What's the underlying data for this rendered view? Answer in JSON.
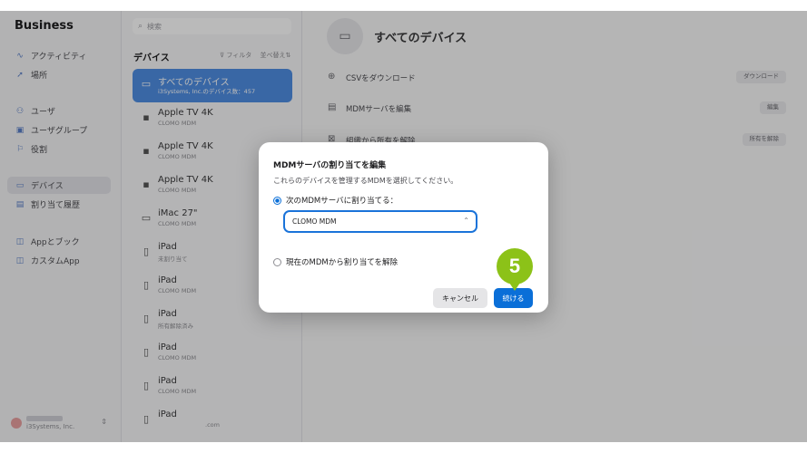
{
  "sidebar": {
    "brand": "Business",
    "items": [
      {
        "label": "アクティビティ",
        "icon": "activity-icon"
      },
      {
        "label": "場所",
        "icon": "location-icon"
      },
      {
        "label": "ユーザ",
        "icon": "users-icon"
      },
      {
        "label": "ユーザグループ",
        "icon": "user-group-icon"
      },
      {
        "label": "役割",
        "icon": "flag-icon"
      },
      {
        "label": "デバイス",
        "icon": "device-icon"
      },
      {
        "label": "割り当て履歴",
        "icon": "history-icon"
      },
      {
        "label": "Appとブック",
        "icon": "apps-icon"
      },
      {
        "label": "カスタムApp",
        "icon": "custom-app-icon"
      }
    ],
    "account": {
      "org": "i3Systems, Inc."
    }
  },
  "list": {
    "search_placeholder": "検索",
    "title": "デバイス",
    "filter_label": "フィルタ",
    "sort_label": "並べ替え",
    "rows": [
      {
        "name": "すべてのデバイス",
        "sub": "i3Systems, Inc.のデバイス数：457",
        "icon": "all-devices-icon"
      },
      {
        "name": "Apple TV 4K",
        "sub": "CLOMO MDM",
        "icon": "apple-tv-icon"
      },
      {
        "name": "Apple TV 4K",
        "sub": "CLOMO MDM",
        "icon": "apple-tv-icon"
      },
      {
        "name": "Apple TV 4K",
        "sub": "CLOMO MDM",
        "icon": "apple-tv-icon"
      },
      {
        "name": "iMac 27\"",
        "sub": "CLOMO MDM",
        "icon": "imac-icon"
      },
      {
        "name": "iPad",
        "sub": "未割り当て",
        "icon": "ipad-icon"
      },
      {
        "name": "iPad",
        "sub": "CLOMO MDM",
        "icon": "ipad-icon"
      },
      {
        "name": "iPad",
        "sub": "所有解除済み",
        "icon": "ipad-icon"
      },
      {
        "name": "iPad",
        "sub": "CLOMO MDM",
        "icon": "ipad-icon"
      },
      {
        "name": "iPad",
        "sub": "CLOMO MDM",
        "icon": "ipad-icon"
      },
      {
        "name": "iPad",
        "sub": ".com",
        "icon": "ipad-icon"
      }
    ]
  },
  "detail": {
    "title": "すべてのデバイス",
    "actions": [
      {
        "label": "CSVをダウンロード",
        "button": "ダウンロード",
        "icon": "download-icon"
      },
      {
        "label": "MDMサーバを編集",
        "button": "編集",
        "icon": "server-icon"
      },
      {
        "label": "組織から所有を解除",
        "button": "所有を解除",
        "icon": "release-icon"
      }
    ]
  },
  "dialog": {
    "title": "MDMサーバの割り当てを編集",
    "description": "これらのデバイスを管理するMDMを選択してください。",
    "option_assign": "次のMDMサーバに割り当てる：",
    "selected_server": "CLOMO MDM",
    "option_unassign": "現在のMDMから割り当てを解除",
    "cancel_label": "キャンセル",
    "continue_label": "続ける"
  },
  "annotation": {
    "step": "5",
    "color": "#8cc218"
  },
  "colors": {
    "accent": "#0a6fd8",
    "selected_row": "#4f8ee2"
  }
}
